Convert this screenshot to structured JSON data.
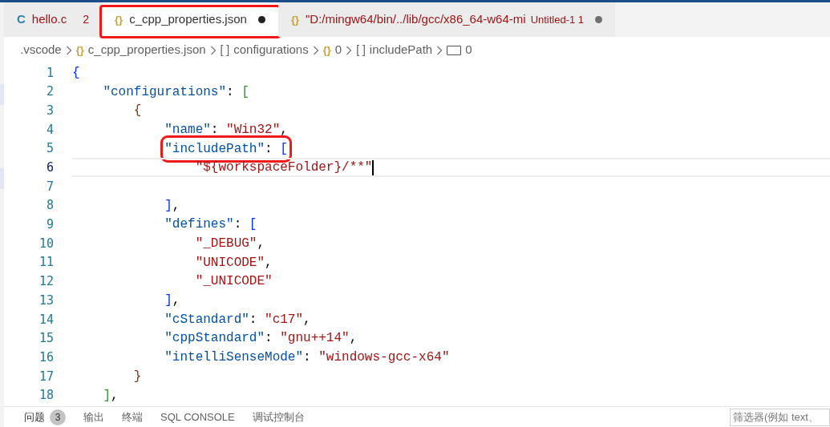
{
  "tabs": [
    {
      "icon": "C",
      "label": "hello.c",
      "problems": "2",
      "selected": false,
      "dirty": false,
      "highlighted": false
    },
    {
      "icon": "{}",
      "label": "c_cpp_properties.json",
      "selected": true,
      "dirty": true,
      "highlighted": true
    },
    {
      "icon": "{}",
      "label": "\"D:/mingw64/bin/../lib/gcc/x86_64-w64-mi",
      "description": "Untitled-1 1",
      "selected": false,
      "dirty": true,
      "highlighted": false
    }
  ],
  "breadcrumbs": [
    {
      "kind": "folder",
      "label": ".vscode"
    },
    {
      "kind": "object",
      "icon": "{}",
      "label": "c_cpp_properties.json"
    },
    {
      "kind": "array",
      "icon": "[ ]",
      "label": "configurations"
    },
    {
      "kind": "object",
      "icon": "{}",
      "label": "0"
    },
    {
      "kind": "array",
      "icon": "[ ]",
      "label": "includePath"
    },
    {
      "kind": "string",
      "label": "0"
    }
  ],
  "lines": [
    {
      "number": "1",
      "tokens": [
        {
          "kind": "bracket",
          "color": "#0431fa",
          "text": "{"
        }
      ]
    },
    {
      "number": "2",
      "tokens": [
        {
          "kind": "key",
          "text": "    \"configurations\""
        },
        {
          "kind": "punct",
          "text": ": "
        },
        {
          "kind": "bracket",
          "color": "#319331",
          "text": "["
        }
      ]
    },
    {
      "number": "3",
      "tokens": [
        {
          "kind": "bracket",
          "color": "#7b3814",
          "text": "        {"
        }
      ]
    },
    {
      "number": "4",
      "tokens": [
        {
          "kind": "key",
          "text": "            \"name\""
        },
        {
          "kind": "punct",
          "text": ": "
        },
        {
          "kind": "string",
          "text": "\"Win32\""
        },
        {
          "kind": "punct",
          "text": ","
        }
      ]
    },
    {
      "number": "5",
      "highlighted": true,
      "tokens": [
        {
          "kind": "key",
          "text": "            \"includePath\""
        },
        {
          "kind": "punct",
          "text": ": "
        },
        {
          "kind": "bracket",
          "color": "#0431fa",
          "text": "["
        }
      ]
    },
    {
      "number": "6",
      "current": true,
      "tokens": [
        {
          "kind": "string",
          "text": "                \"${workspaceFolder}/**\""
        }
      ]
    },
    {
      "number": "7"
    },
    {
      "number": "8",
      "tokens": [
        {
          "kind": "bracket",
          "color": "#0431fa",
          "text": "            ]"
        },
        {
          "kind": "punct",
          "text": ","
        }
      ]
    },
    {
      "number": "9",
      "tokens": [
        {
          "kind": "key",
          "text": "            \"defines\""
        },
        {
          "kind": "punct",
          "text": ": "
        },
        {
          "kind": "bracket",
          "color": "#0431fa",
          "text": "["
        }
      ]
    },
    {
      "number": "10",
      "tokens": [
        {
          "kind": "string",
          "text": "                \"_DEBUG\""
        },
        {
          "kind": "punct",
          "text": ","
        }
      ]
    },
    {
      "number": "11",
      "tokens": [
        {
          "kind": "string",
          "text": "                \"UNICODE\""
        },
        {
          "kind": "punct",
          "text": ","
        }
      ]
    },
    {
      "number": "12",
      "tokens": [
        {
          "kind": "string",
          "text": "                \"_UNICODE\""
        }
      ]
    },
    {
      "number": "13",
      "tokens": [
        {
          "kind": "bracket",
          "color": "#0431fa",
          "text": "            ]"
        },
        {
          "kind": "punct",
          "text": ","
        }
      ]
    },
    {
      "number": "14",
      "tokens": [
        {
          "kind": "key",
          "text": "            \"cStandard\""
        },
        {
          "kind": "punct",
          "text": ": "
        },
        {
          "kind": "string",
          "text": "\"c17\""
        },
        {
          "kind": "punct",
          "text": ","
        }
      ]
    },
    {
      "number": "15",
      "tokens": [
        {
          "kind": "key",
          "text": "            \"cppStandard\""
        },
        {
          "kind": "punct",
          "text": ": "
        },
        {
          "kind": "string",
          "text": "\"gnu++14\""
        },
        {
          "kind": "punct",
          "text": ","
        }
      ]
    },
    {
      "number": "16",
      "tokens": [
        {
          "kind": "key",
          "text": "            \"intelliSenseMode\""
        },
        {
          "kind": "punct",
          "text": ": "
        },
        {
          "kind": "string",
          "text": "\"windows-gcc-x64\""
        }
      ]
    },
    {
      "number": "17",
      "tokens": [
        {
          "kind": "bracket",
          "color": "#7b3814",
          "text": "        }"
        }
      ]
    },
    {
      "number": "18",
      "tokens": [
        {
          "kind": "bracket",
          "color": "#319331",
          "text": "    ]"
        },
        {
          "kind": "punct",
          "text": ","
        }
      ]
    }
  ],
  "panel": {
    "tabs": [
      {
        "label": "问题",
        "badge": "3",
        "selected": true
      },
      {
        "label": "输出",
        "selected": false
      },
      {
        "label": "终端",
        "selected": false
      },
      {
        "label": "SQL CONSOLE",
        "selected": false
      },
      {
        "label": "调试控制台",
        "selected": false
      }
    ],
    "filter": {
      "placeholder": "筛选器(例如 text、"
    }
  }
}
